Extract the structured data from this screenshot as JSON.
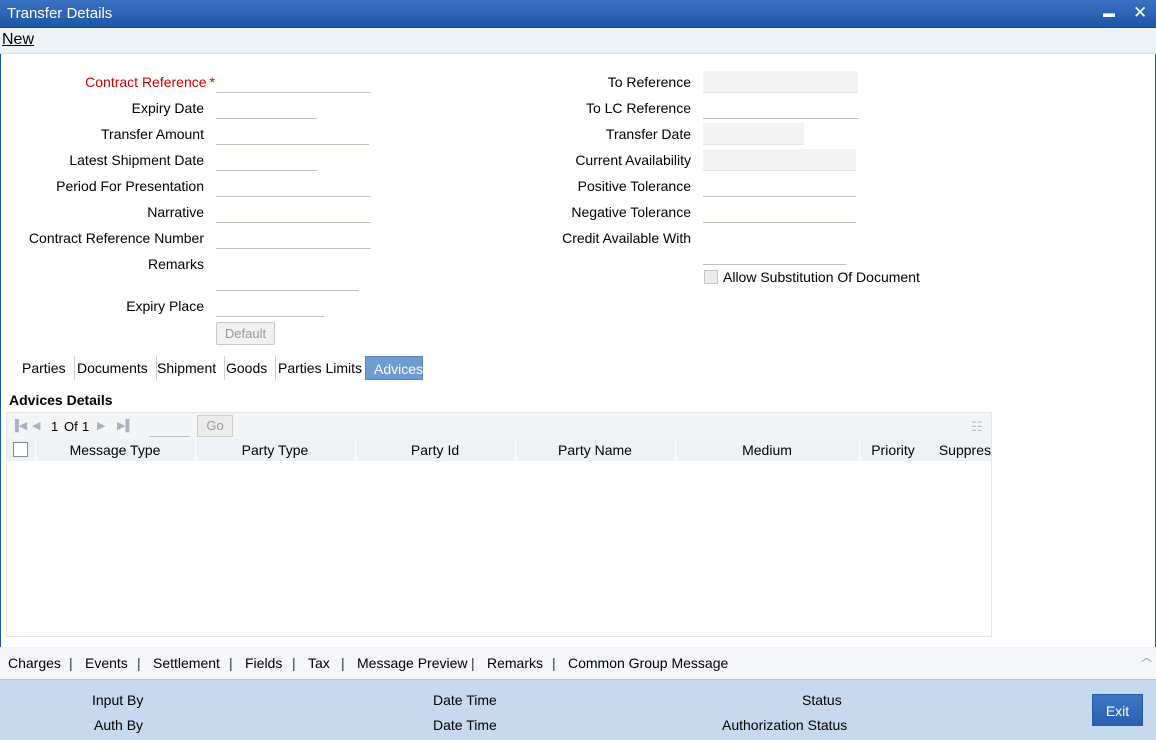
{
  "window": {
    "title": "Transfer Details",
    "minimize_glyph": "▬",
    "close_glyph": "✕"
  },
  "menu": {
    "new_label": "New"
  },
  "form": {
    "left": {
      "contract_reference": "Contract Reference",
      "required_star": "*",
      "expiry_date": "Expiry Date",
      "transfer_amount": "Transfer Amount",
      "latest_shipment_date": "Latest Shipment Date",
      "period_for_presentation": "Period For Presentation",
      "narrative": "Narrative",
      "contract_reference_number": "Contract Reference Number",
      "remarks": "Remarks",
      "expiry_place": "Expiry Place",
      "default_button": "Default"
    },
    "right": {
      "to_reference": "To Reference",
      "to_lc_reference": "To LC Reference",
      "transfer_date": "Transfer Date",
      "current_availability": "Current Availability",
      "positive_tolerance": "Positive Tolerance",
      "negative_tolerance": "Negative Tolerance",
      "credit_available_with": "Credit Available With",
      "allow_substitution": "Allow Substitution Of Document"
    }
  },
  "tabs": [
    "Parties",
    "Documents",
    "Shipment",
    "Goods",
    "Parties Limits",
    "Advices"
  ],
  "advices": {
    "title": "Advices Details",
    "pager": {
      "current": "1",
      "of_label": "Of",
      "total": "1",
      "go_label": "Go"
    },
    "columns": [
      "Message Type",
      "Party Type",
      "Party Id",
      "Party Name",
      "Medium",
      "Priority",
      "Suppres"
    ]
  },
  "footer_links": [
    "Charges",
    "Events",
    "Settlement",
    "Fields",
    "Tax",
    "Message Preview",
    "Remarks",
    "Common Group Message"
  ],
  "status": {
    "input_by": "Input By",
    "auth_by": "Auth By",
    "date_time_1": "Date Time",
    "date_time_2": "Date Time",
    "status": "Status",
    "authorization_status": "Authorization Status",
    "exit_label": "Exit"
  },
  "colors": {
    "title_bar": "#1e56a8",
    "active_tab": "#6f9bd3",
    "status_bar": "#c6d9ef",
    "required": "#cc0000"
  }
}
